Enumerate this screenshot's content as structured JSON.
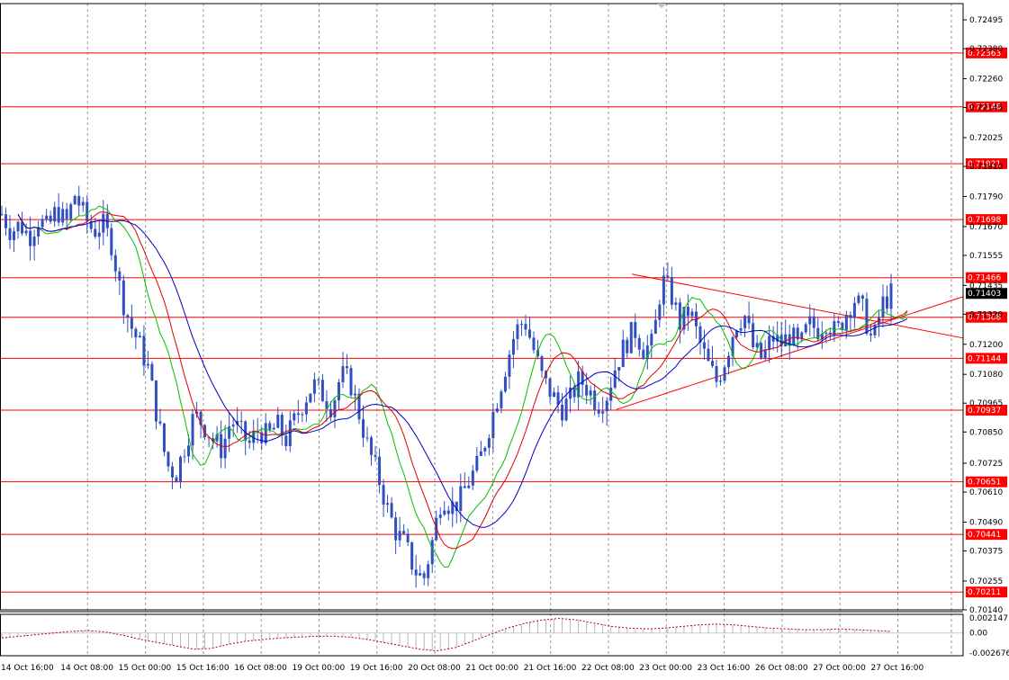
{
  "chart_data": {
    "type": "candlestick",
    "instrument_timeframe": "H2",
    "price_axis": {
      "range": [
        0.7014,
        0.7256
      ],
      "ticks": [
        "0.72495",
        "0.72380",
        "0.72260",
        "0.72145",
        "0.72025",
        "0.71910",
        "0.71790",
        "0.71670",
        "0.71555",
        "0.71435",
        "0.71320",
        "0.71200",
        "0.71080",
        "0.70965",
        "0.70850",
        "0.70725",
        "0.70610",
        "0.70490",
        "0.70375",
        "0.70255",
        "0.70140"
      ]
    },
    "time_axis": {
      "labels": [
        "14 Oct 16:00",
        "14 Oct 08:00",
        "15 Oct 00:00",
        "15 Oct 16:00",
        "16 Oct 08:00",
        "19 Oct 00:00",
        "19 Oct 16:00",
        "20 Oct 08:00",
        "21 Oct 00:00",
        "21 Oct 16:00",
        "22 Oct 08:00",
        "23 Oct 00:00",
        "23 Oct 16:00",
        "26 Oct 08:00",
        "27 Oct 00:00",
        "27 Oct 16:00"
      ]
    },
    "levels": [
      "0.72363",
      "0.72148",
      "0.71921",
      "0.71698",
      "0.71466",
      "0.71308",
      "0.71144",
      "0.70937",
      "0.70651",
      "0.70441",
      "0.70211"
    ],
    "current_price": "0.71403",
    "price_path": [
      0.7172,
      0.7165,
      0.7168,
      0.7163,
      0.717,
      0.7166,
      0.7174,
      0.7168,
      0.718,
      0.7171,
      0.7165,
      0.7168,
      0.716,
      0.714,
      0.7128,
      0.712,
      0.711,
      0.709,
      0.7072,
      0.7068,
      0.708,
      0.7092,
      0.7088,
      0.7082,
      0.7078,
      0.709,
      0.7085,
      0.708,
      0.7086,
      0.7083,
      0.7088,
      0.7082,
      0.709,
      0.7098,
      0.7104,
      0.71,
      0.7095,
      0.7108,
      0.7105,
      0.7092,
      0.7078,
      0.7068,
      0.7055,
      0.7045,
      0.704,
      0.703,
      0.7026,
      0.7042,
      0.706,
      0.7055,
      0.7058,
      0.7066,
      0.7072,
      0.7085,
      0.7098,
      0.7112,
      0.7125,
      0.713,
      0.7118,
      0.7106,
      0.71,
      0.7094,
      0.7098,
      0.7106,
      0.7102,
      0.7096,
      0.71,
      0.7112,
      0.712,
      0.7126,
      0.7118,
      0.712,
      0.7146,
      0.714,
      0.7128,
      0.7134,
      0.7122,
      0.7112,
      0.7105,
      0.7115,
      0.7128,
      0.7132,
      0.7118,
      0.7114,
      0.7123,
      0.712,
      0.7124,
      0.7118,
      0.7128,
      0.7126,
      0.713,
      0.7124,
      0.7132,
      0.7138,
      0.7133,
      0.712,
      0.7136,
      0.714
    ],
    "oscillator": {
      "ticks": [
        "0.002147",
        "0.00",
        "-0.002676"
      ],
      "values": [
        -0.0006,
        -0.0004,
        -0.0002,
        0.0,
        0.0002,
        0.0003,
        0.0001,
        -0.0003,
        -0.0008,
        -0.0012,
        -0.0016,
        -0.002,
        -0.0019,
        -0.0014,
        -0.001,
        -0.0008,
        -0.0006,
        -0.0005,
        -0.0004,
        -0.0004,
        -0.0005,
        -0.0008,
        -0.0012,
        -0.0016,
        -0.002,
        -0.0022,
        -0.0018,
        -0.001,
        -0.0002,
        0.0006,
        0.0012,
        0.0016,
        0.0018,
        0.0016,
        0.0012,
        0.0008,
        0.0006,
        0.0005,
        0.0006,
        0.0008,
        0.001,
        0.0011,
        0.001,
        0.0008,
        0.0006,
        0.0005,
        0.0004,
        0.0004,
        0.0005,
        0.0004,
        0.0003,
        0.0002
      ]
    },
    "colors": {
      "candle": "#3050c0",
      "ma_fast": "#00c000",
      "ma_mid": "#e00000",
      "ma_slow": "#0000c0",
      "level_line": "#ff0000",
      "level_label_bg": "#ff0000",
      "current_label_bg": "#000000",
      "grid": "#9a9a9a",
      "oscillator": "#c00000"
    }
  }
}
